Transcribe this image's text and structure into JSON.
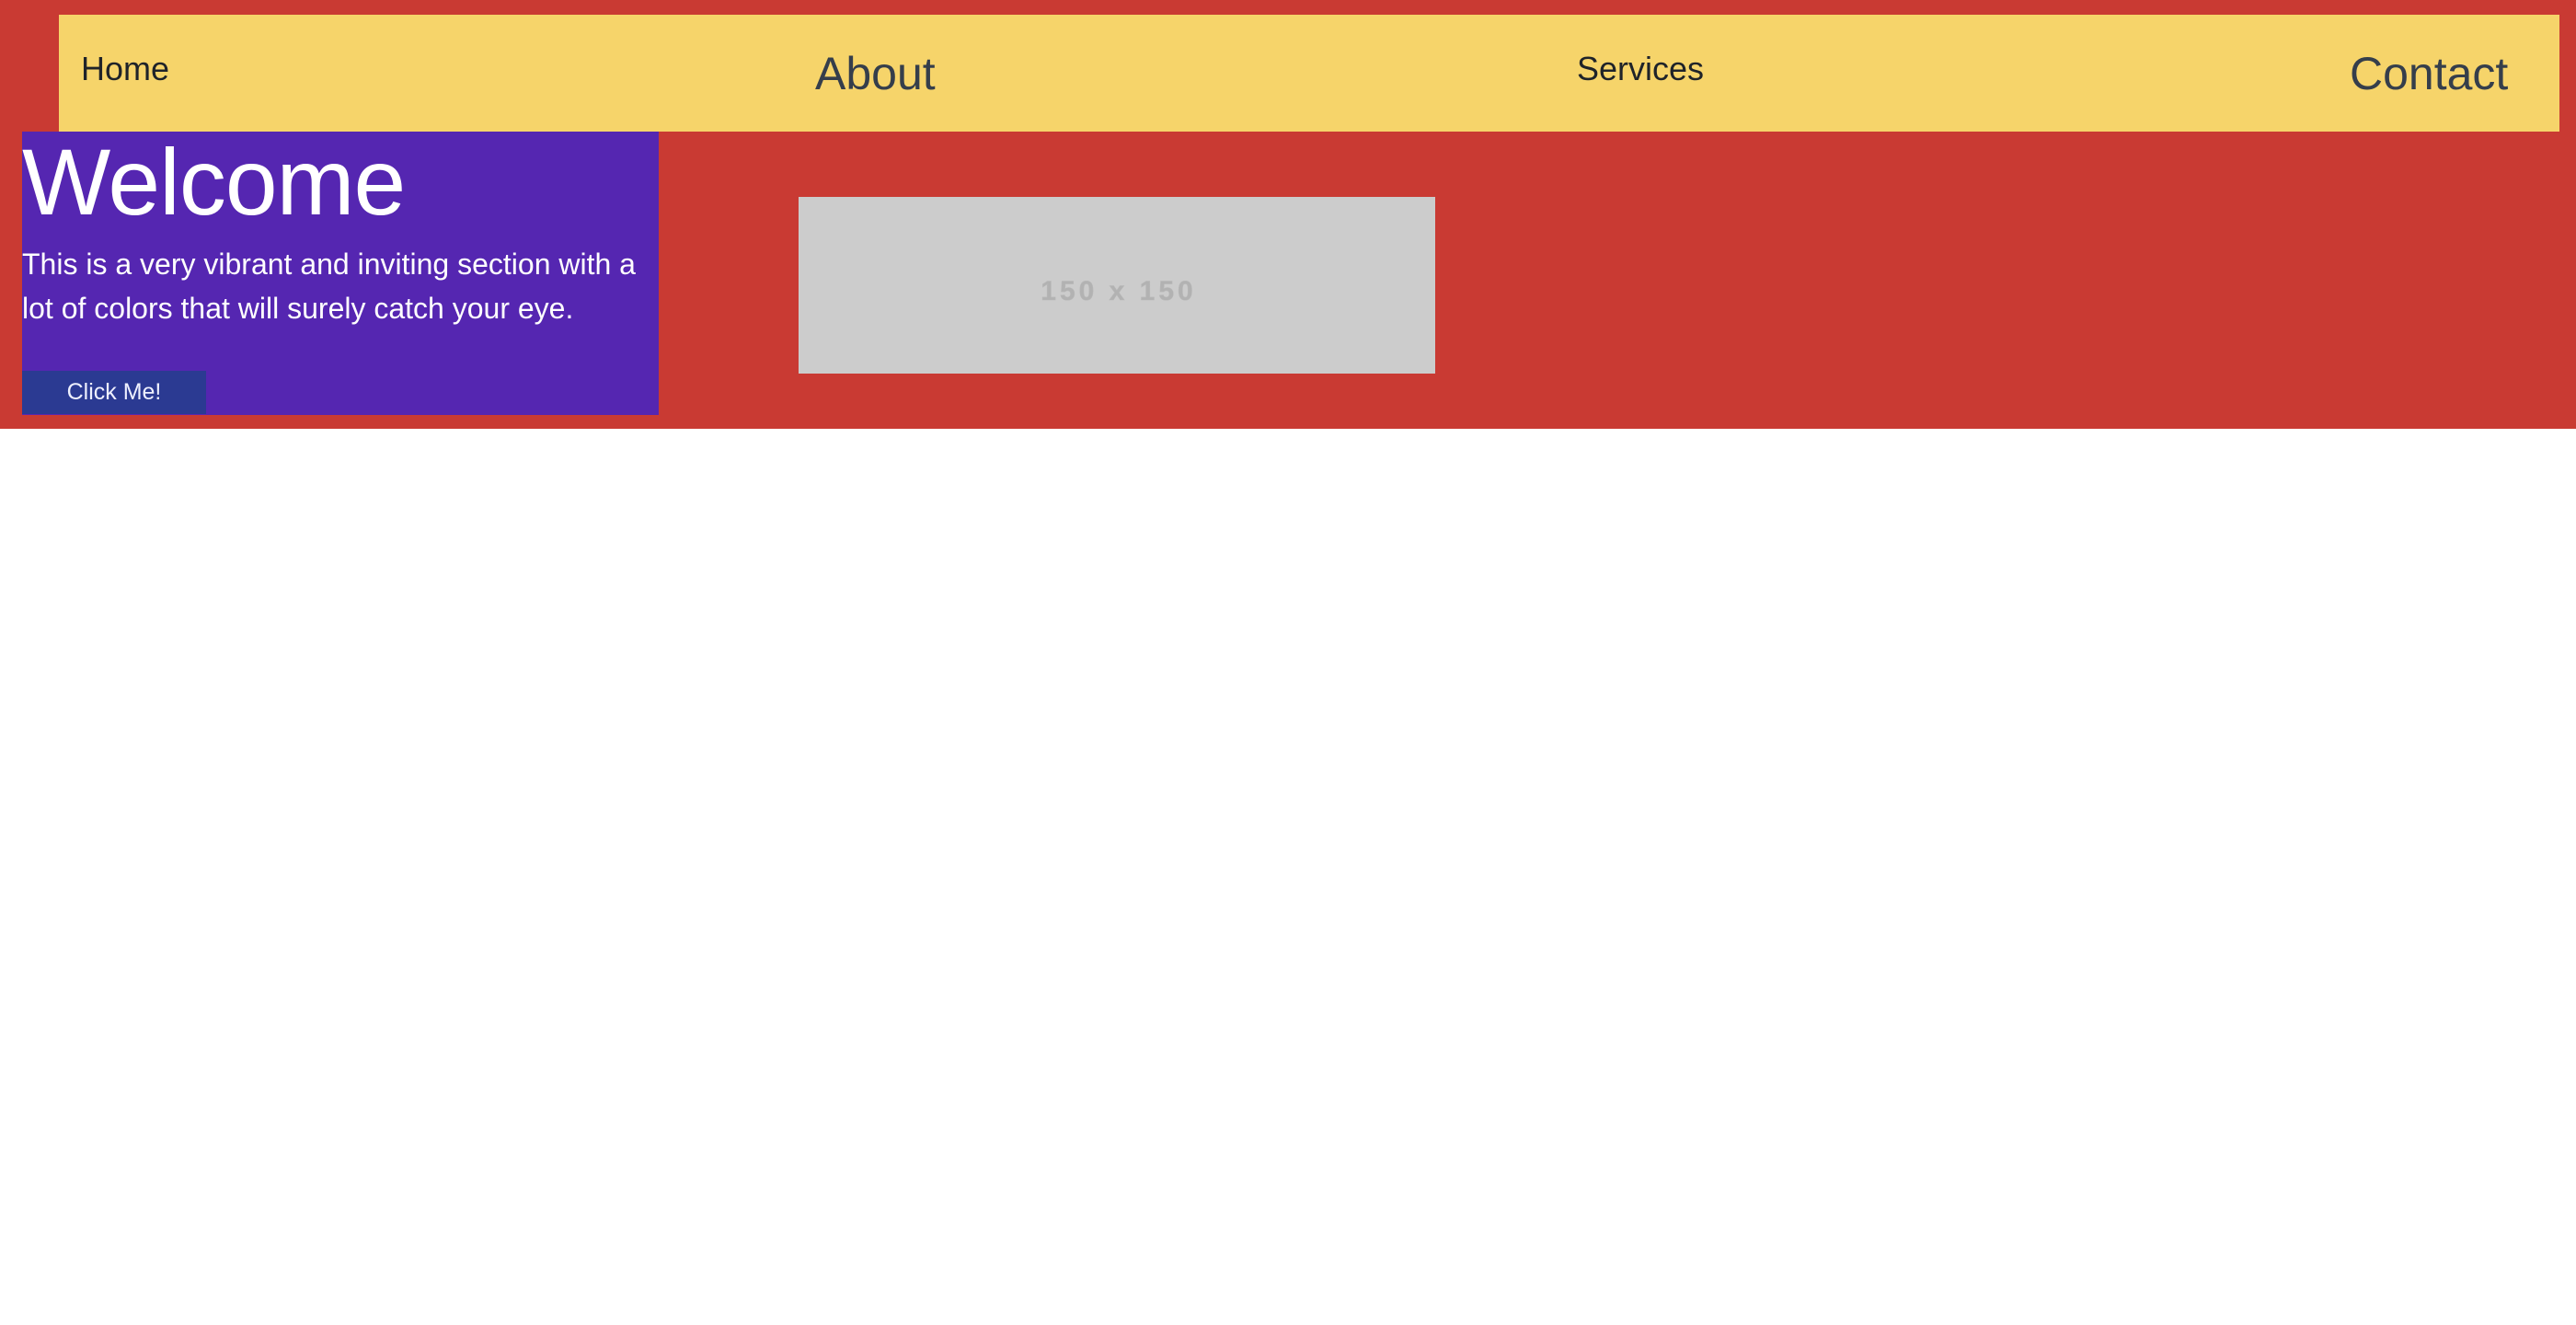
{
  "nav": {
    "items": [
      {
        "label": "Home"
      },
      {
        "label": "About"
      },
      {
        "label": "Services"
      },
      {
        "label": "Contact"
      }
    ]
  },
  "hero": {
    "title": "Welcome",
    "text": "This is a very vibrant and inviting section with a lot of colors that will surely catch your eye.",
    "button_label": "Click Me!"
  },
  "image": {
    "placeholder_text": "150 x 150"
  },
  "colors": {
    "hero_background": "#c93a33",
    "nav_background": "#f6d46a",
    "panel_background": "#5526b1",
    "button_background": "#2b3a92",
    "placeholder_background": "#cccccc"
  }
}
